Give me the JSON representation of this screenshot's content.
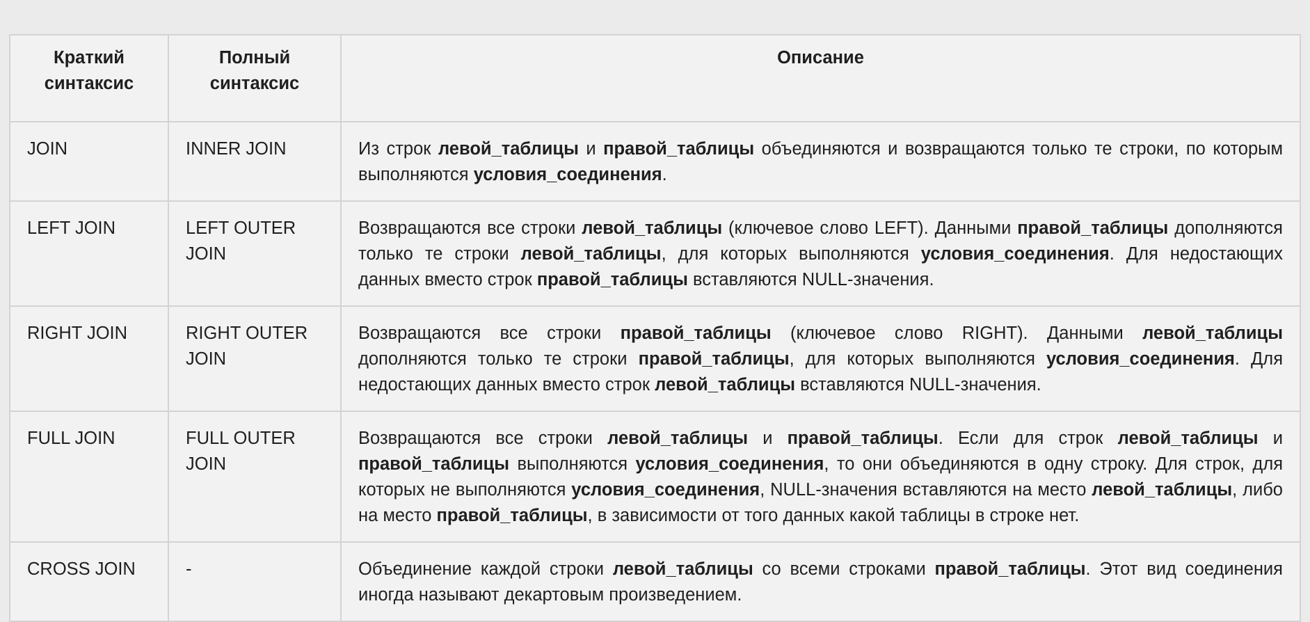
{
  "table": {
    "headers": [
      "Краткий синтаксис",
      "Полный синтаксис",
      "Описание"
    ],
    "rows": [
      {
        "short": "JOIN",
        "full": "INNER JOIN",
        "description": [
          {
            "t": "Из строк "
          },
          {
            "t": "левой_таблицы",
            "b": true
          },
          {
            "t": " и "
          },
          {
            "t": "правой_таблицы",
            "b": true
          },
          {
            "t": " объединяются и возвращаются только те строки, по которым выполняются "
          },
          {
            "t": "условия_соединения",
            "b": true
          },
          {
            "t": "."
          }
        ]
      },
      {
        "short": "LEFT JOIN",
        "full": "LEFT OUTER JOIN",
        "description": [
          {
            "t": "Возвращаются все строки "
          },
          {
            "t": "левой_таблицы",
            "b": true
          },
          {
            "t": " (ключевое слово LEFT). Данными "
          },
          {
            "t": "правой_таблицы",
            "b": true
          },
          {
            "t": " дополняются только те строки "
          },
          {
            "t": "левой_таблицы",
            "b": true
          },
          {
            "t": ", для которых выполняются "
          },
          {
            "t": "условия_соединения",
            "b": true
          },
          {
            "t": ". Для недостающих данных вместо строк "
          },
          {
            "t": "правой_таблицы",
            "b": true
          },
          {
            "t": " вставляются NULL-значения."
          }
        ]
      },
      {
        "short": "RIGHT JOIN",
        "full": "RIGHT OUTER JOIN",
        "description": [
          {
            "t": "Возвращаются все строки "
          },
          {
            "t": "правой_таблицы",
            "b": true
          },
          {
            "t": " (ключевое слово RIGHT). Данными "
          },
          {
            "t": "левой_таблицы",
            "b": true
          },
          {
            "t": " дополняются только те строки "
          },
          {
            "t": "правой_таблицы",
            "b": true
          },
          {
            "t": ", для которых выполняются "
          },
          {
            "t": "условия_соединения",
            "b": true
          },
          {
            "t": ". Для недостающих данных вместо строк "
          },
          {
            "t": "левой_таблицы",
            "b": true
          },
          {
            "t": " вставляются NULL-значения."
          }
        ]
      },
      {
        "short": "FULL JOIN",
        "full": "FULL OUTER JOIN",
        "description": [
          {
            "t": "Возвращаются все строки "
          },
          {
            "t": "левой_таблицы",
            "b": true
          },
          {
            "t": " и "
          },
          {
            "t": "правой_таблицы",
            "b": true
          },
          {
            "t": ". Если для строк "
          },
          {
            "t": "левой_таблицы",
            "b": true
          },
          {
            "t": " и "
          },
          {
            "t": "правой_таблицы",
            "b": true
          },
          {
            "t": " выполняются "
          },
          {
            "t": "условия_соединения",
            "b": true
          },
          {
            "t": ", то они объединяются в одну строку. Для строк, для которых не выполняются "
          },
          {
            "t": "условия_соединения",
            "b": true
          },
          {
            "t": ", NULL-значения вставляются на место "
          },
          {
            "t": "левой_таблицы",
            "b": true
          },
          {
            "t": ", либо на место "
          },
          {
            "t": "правой_таблицы",
            "b": true
          },
          {
            "t": ", в зависимости от того данных какой таблицы в строке нет."
          }
        ]
      },
      {
        "short": "CROSS JOIN",
        "full": "-",
        "description": [
          {
            "t": "Объединение каждой строки "
          },
          {
            "t": "левой_таблицы",
            "b": true
          },
          {
            "t": " со всеми строками "
          },
          {
            "t": "правой_таблицы",
            "b": true
          },
          {
            "t": ". Этот вид соединения иногда называют декартовым произведением."
          }
        ]
      }
    ]
  }
}
